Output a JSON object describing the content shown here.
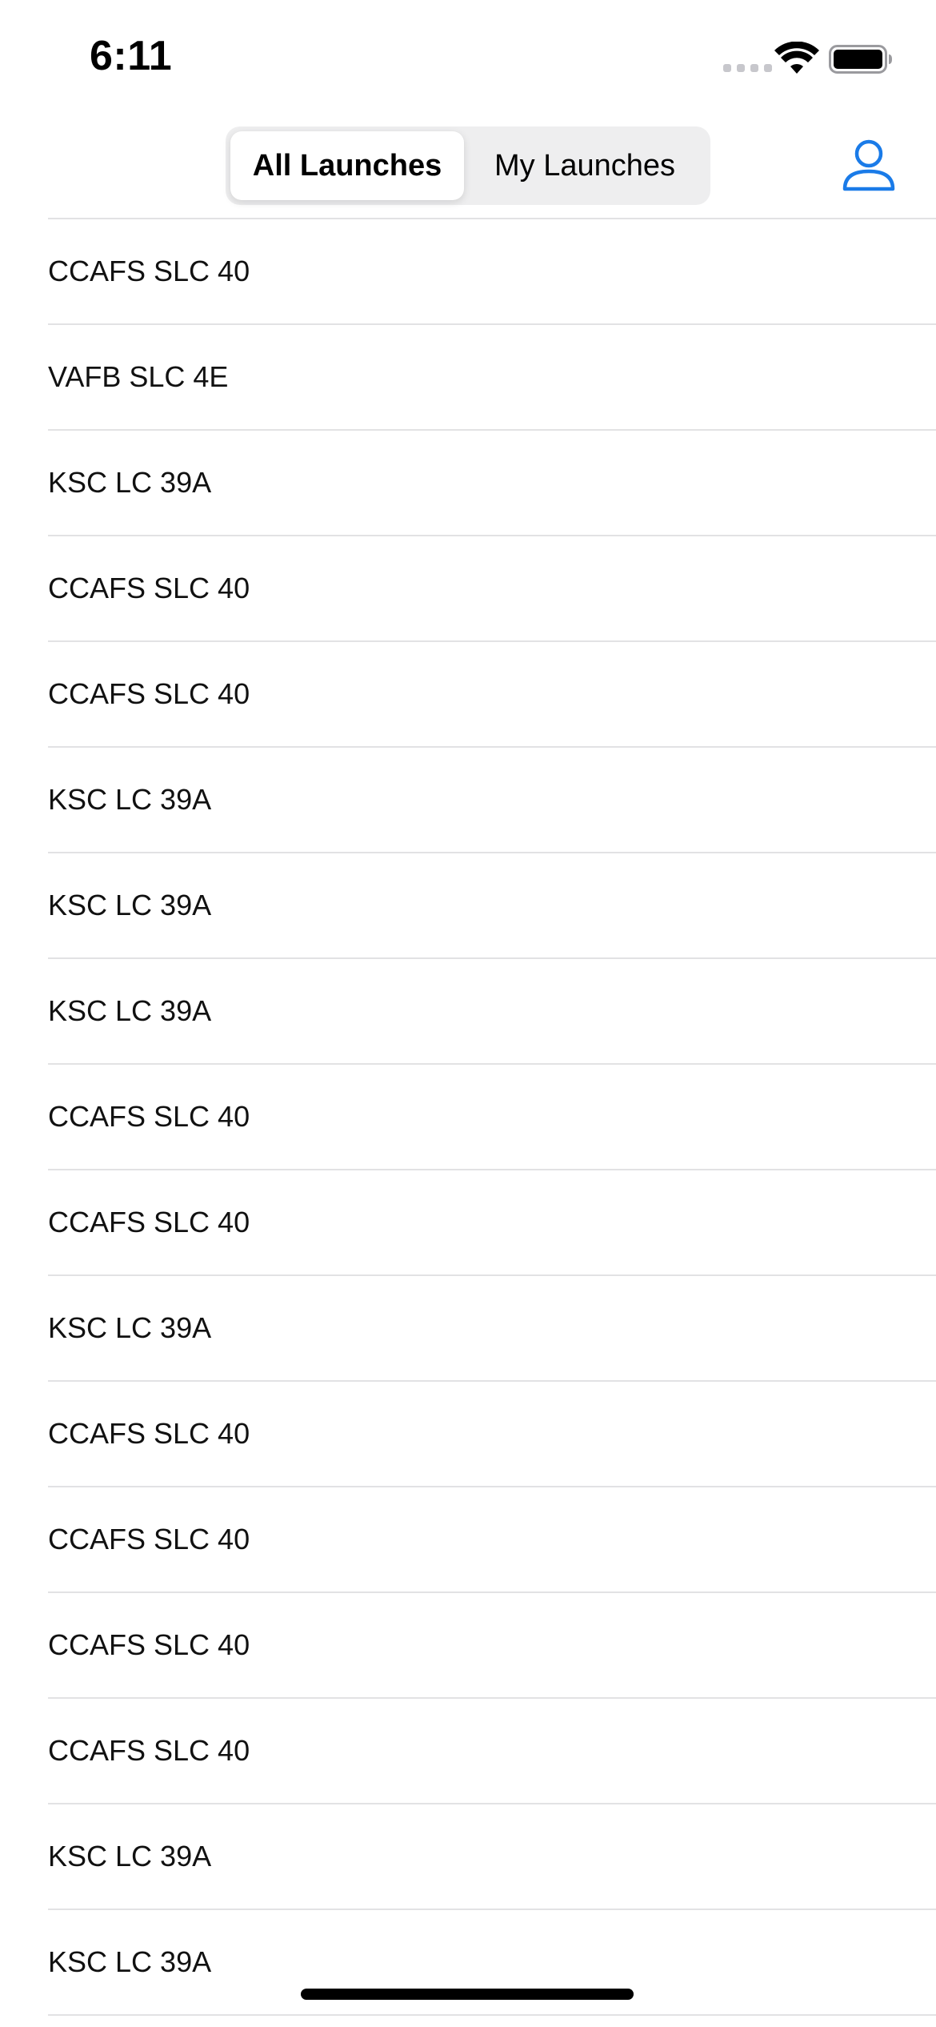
{
  "status_bar": {
    "time": "6:11",
    "icons": [
      "cellular-signal-icon",
      "wifi-icon",
      "battery-icon"
    ]
  },
  "nav": {
    "segments": [
      {
        "label": "All Launches",
        "selected": true
      },
      {
        "label": "My Launches",
        "selected": false
      }
    ],
    "profile_icon": "person-icon",
    "accent_color": "#1a7be8"
  },
  "launches": [
    "CCAFS SLC 40",
    "VAFB SLC 4E",
    "KSC LC 39A",
    "CCAFS SLC 40",
    "CCAFS SLC 40",
    "KSC LC 39A",
    "KSC LC 39A",
    "KSC LC 39A",
    "CCAFS SLC 40",
    "CCAFS SLC 40",
    "KSC LC 39A",
    "CCAFS SLC 40",
    "CCAFS SLC 40",
    "CCAFS SLC 40",
    "CCAFS SLC 40",
    "KSC LC 39A",
    "KSC LC 39A"
  ]
}
